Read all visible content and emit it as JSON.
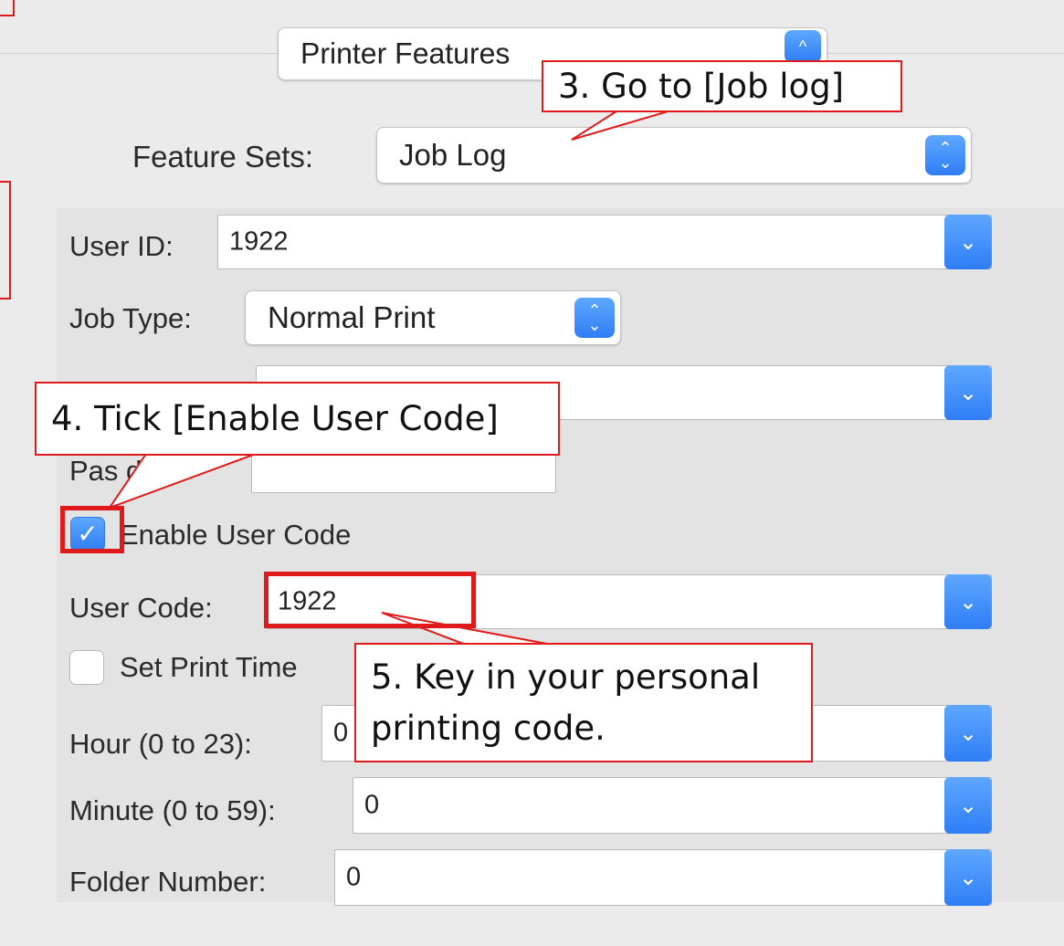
{
  "header": {
    "features_popup": "Printer Features",
    "popup_stepper_icon": "chevron-up"
  },
  "feature_sets": {
    "label": "Feature Sets:",
    "value": "Job Log"
  },
  "fields": {
    "user_id": {
      "label": "User ID:",
      "value": "1922"
    },
    "job_type": {
      "label": "Job Type:",
      "value": "Normal Print"
    },
    "password": {
      "label": "Password:",
      "visible_label": "Pas      d:",
      "value": ""
    },
    "enable_user_code": {
      "label": "Enable User Code",
      "checked": true
    },
    "user_code": {
      "label": "User Code:",
      "value": "1922"
    },
    "set_print_time": {
      "label": "Set Print Time",
      "checked": false
    },
    "hour": {
      "label": "Hour (0 to 23):",
      "value": "0"
    },
    "minute": {
      "label": "Minute (0 to 59):",
      "value": "0"
    },
    "folder_number": {
      "label": "Folder Number:",
      "value": "0"
    }
  },
  "callouts": {
    "step3": "3. Go to [Job log]",
    "step4": "4. Tick [Enable User Code]",
    "step5_line1": "5. Key in your personal",
    "step5_line2": "printing code."
  },
  "colors": {
    "accent_blue": "#2f7df6",
    "callout_red": "#e01a1a",
    "panel_bg": "#ebebeb"
  }
}
